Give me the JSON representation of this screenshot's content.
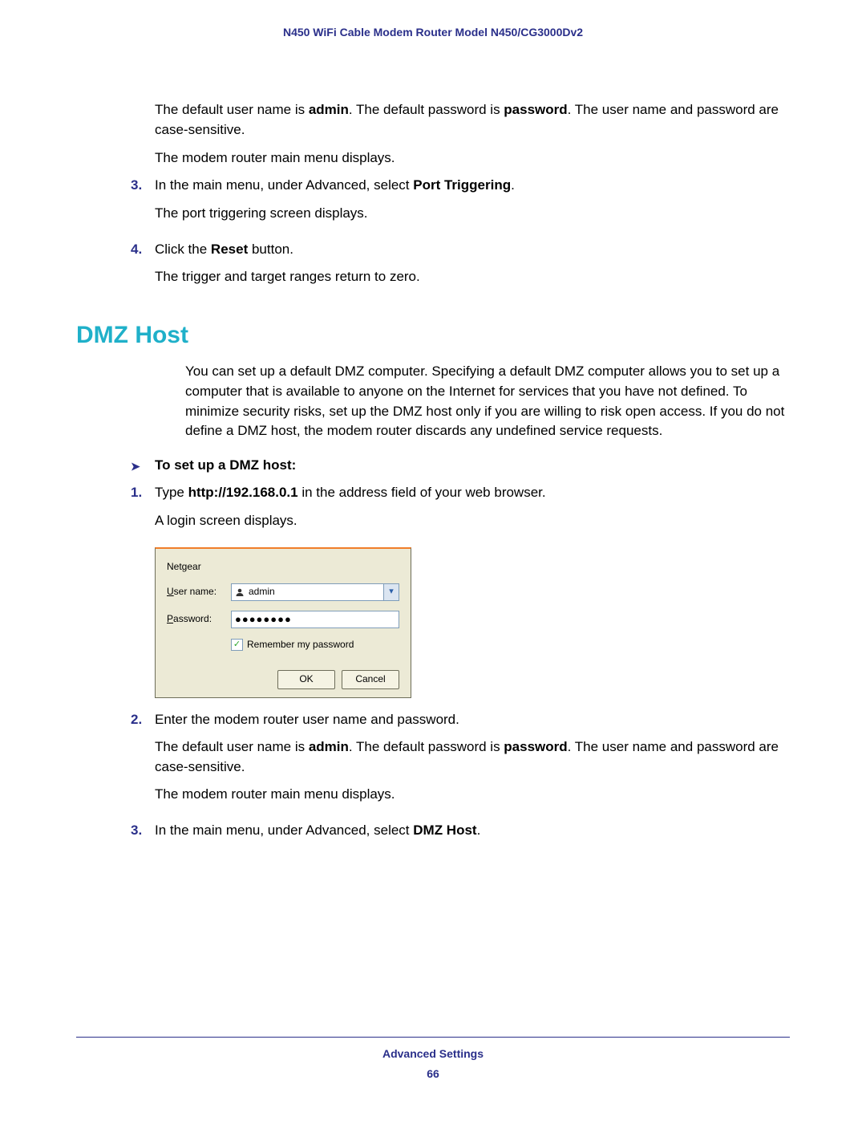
{
  "header": "N450 WiFi Cable Modem Router Model N450/CG3000Dv2",
  "top": {
    "p1a": "The default user name is ",
    "p1b": "admin",
    "p1c": ". The default password is ",
    "p1d": "password",
    "p1e": ". The user name and password are case-sensitive.",
    "p2": "The modem router main menu displays."
  },
  "step3": {
    "num": "3.",
    "a": "In the main menu, under Advanced, select ",
    "b": "Port Triggering",
    "c": ".",
    "p": "The port triggering screen displays."
  },
  "step4": {
    "num": "4.",
    "a": "Click the ",
    "b": "Reset",
    "c": " button.",
    "p": "The trigger and target ranges return to zero."
  },
  "section": "DMZ Host",
  "dmz_intro": "You can set up a default DMZ computer. Specifying a default DMZ computer allows you to set up a computer that is available to anyone on the Internet for services that you have not defined. To minimize security risks, set up the DMZ host only if you are willing to risk open access. If you do not define a DMZ host, the modem router discards any undefined service requests.",
  "task_arrow": "➤",
  "task": "To set up a DMZ host:",
  "d1": {
    "num": "1.",
    "a": "Type ",
    "b": "http://192.168.0.1",
    "c": " in the address field of your web browser.",
    "p": "A login screen displays."
  },
  "login": {
    "realm": "Netgear",
    "user_label_u": "U",
    "user_label_rest": "ser name:",
    "user_value": "admin",
    "pass_label_u": "P",
    "pass_label_rest": "assword:",
    "pass_dots": "●●●●●●●●",
    "remember_u": "R",
    "remember_rest": "emember my password",
    "ok": "OK",
    "cancel": "Cancel"
  },
  "d2": {
    "num": "2.",
    "text": "Enter the modem router user name and password.",
    "p1a": "The default user name is ",
    "p1b": "admin",
    "p1c": ". The default password is ",
    "p1d": "password",
    "p1e": ". The user name and password are case-sensitive.",
    "p2": "The modem router main menu displays."
  },
  "d3": {
    "num": "3.",
    "a": "In the main menu, under Advanced, select ",
    "b": "DMZ Host",
    "c": "."
  },
  "footer": {
    "section": "Advanced Settings",
    "page": "66"
  }
}
